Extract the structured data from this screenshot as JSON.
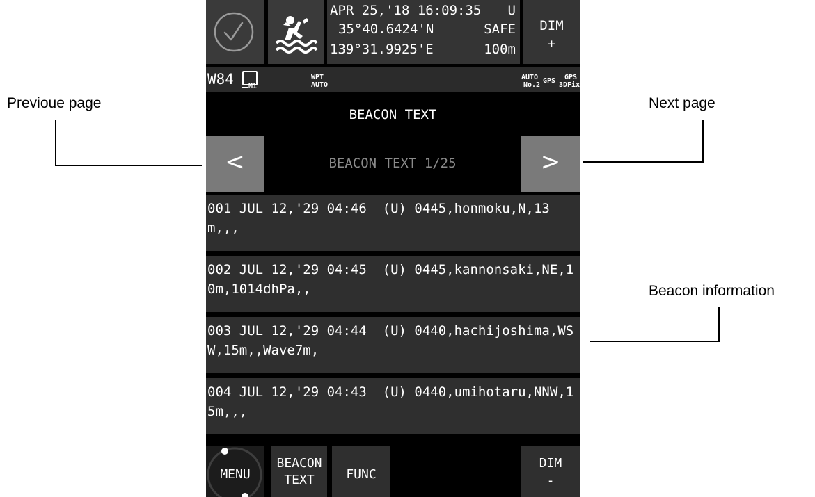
{
  "callouts": {
    "previous_page": "Previoue page",
    "next_page": "Next page",
    "beacon_info": "Beacon information"
  },
  "header": {
    "date_time": "APR 25,'18 16:09:35",
    "time_zone": "U",
    "latitude": "35°40.6424'N",
    "longitude": "139°31.9925'E",
    "safe_label": "SAFE",
    "safe_range": "100m",
    "dim_plus_label": "DIM",
    "dim_plus_sign": "+",
    "check_icon": "check-circle-icon",
    "person_icon": "person-overboard-icon"
  },
  "status": {
    "datum": "W84",
    "mode_sub": "M1",
    "wpt_label": "WPT",
    "wpt_mode": "AUTO",
    "auto_label": "AUTO",
    "auto_no": "No.2",
    "gps_label": "GPS",
    "gps_fix_label": "GPS",
    "gps_fix_value": "3DFix"
  },
  "page": {
    "title": "BEACON TEXT",
    "subtitle": "BEACON TEXT 1/25",
    "prev_label": "<",
    "next_label": ">"
  },
  "beacons": [
    {
      "text": "001 JUL 12,'29 04:46  (U) 0445,honmoku,N,13m,,,"
    },
    {
      "text": "002 JUL 12,'29 04:45  (U) 0445,kannonsaki,NE,10m,1014dhPa,,"
    },
    {
      "text": "003 JUL 12,'29 04:44  (U) 0440,hachijoshima,WSW,15m,,Wave7m,"
    },
    {
      "text": "004 JUL 12,'29 04:43  (U) 0440,umihotaru,NNW,15m,,,"
    }
  ],
  "softkeys": {
    "menu": "MENU",
    "beacon_line1": "BEACON",
    "beacon_line2": "TEXT",
    "func": "FUNC",
    "dim_minus_label": "DIM",
    "dim_minus_sign": "-"
  },
  "colors": {
    "screen_bg": "#000000",
    "tile_bg": "#2f2f2f",
    "nav_button_bg": "#7a7a7a",
    "subtitle_text": "#8a8a8a"
  }
}
